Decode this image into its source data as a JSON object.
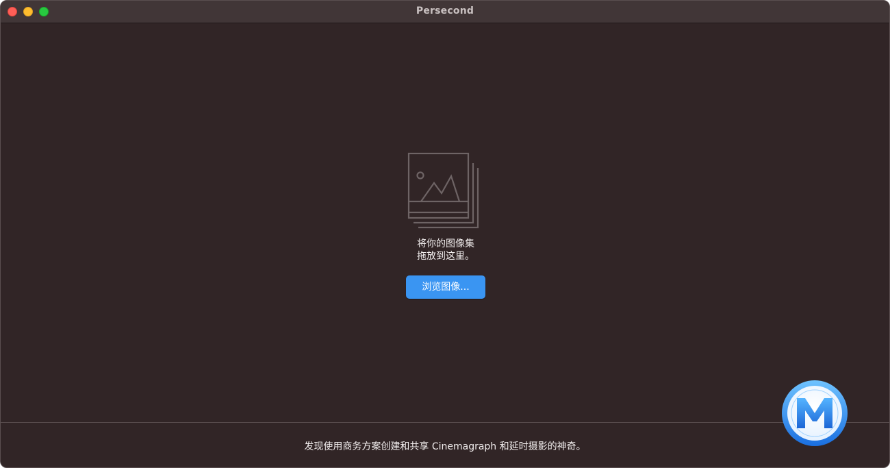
{
  "window": {
    "title": "Persecond"
  },
  "drop_zone": {
    "icon": "image-stack-icon",
    "line1": "将你的图像集",
    "line2": "拖放到这里。",
    "browse_button_label": "浏览图像..."
  },
  "footer": {
    "text": "发现使用商务方案创建和共享 Cinemagraph 和延时摄影的神奇。"
  },
  "watermark": {
    "icon": "m-logo-icon"
  },
  "colors": {
    "window_bg": "#312526",
    "titlebar_bg": "#413637",
    "accent": "#3a95f2",
    "close": "#fe5f57",
    "minimize": "#febc2e",
    "zoom": "#28c840"
  }
}
